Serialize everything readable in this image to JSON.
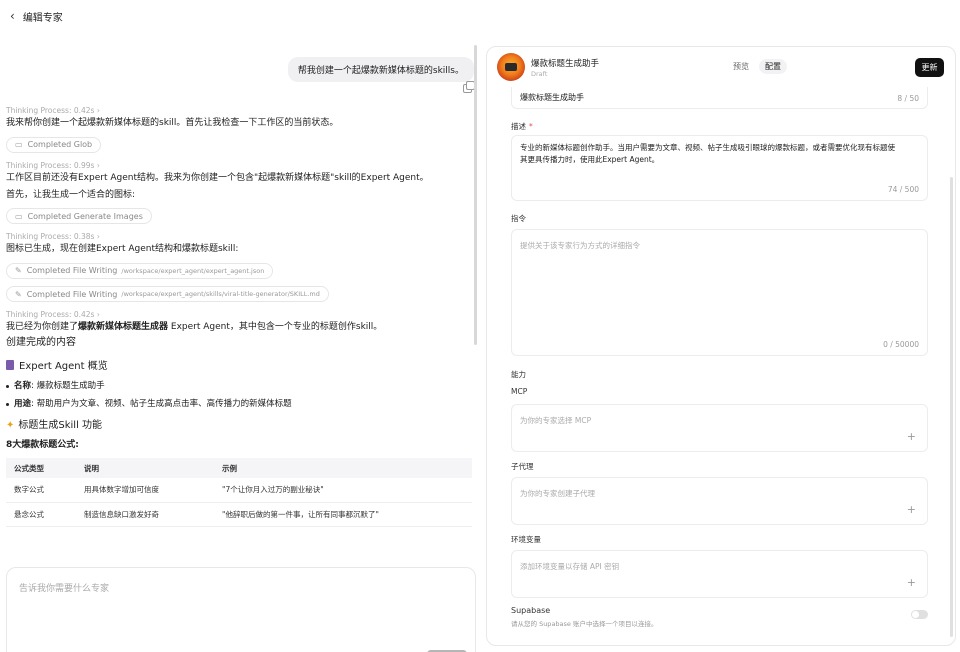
{
  "header": {
    "title": "编辑专家"
  },
  "chat": {
    "user_message": "帮我创建一个起爆款新媒体标题的skills。",
    "t1": "Thinking Process: 0.42s",
    "m1": "我来帮你创建一个起爆款新媒体标题的skill。首先让我检查一下工作区的当前状态。",
    "p1": "Completed Glob",
    "t2": "Thinking Process: 0.99s",
    "m2": "工作区目前还没有Expert Agent结构。我来为你创建一个包含\"起爆款新媒体标题\"skill的Expert Agent。",
    "m2b": "首先，让我生成一个适合的图标:",
    "p2": "Completed Generate Images",
    "t3": "Thinking Process: 0.38s",
    "m3": "图标已生成，现在创建Expert Agent结构和爆款标题skill:",
    "p3": "Completed File Writing",
    "p3path": "/workspace/expert_agent/expert_agent.json",
    "p4": "Completed File Writing",
    "p4path": "/workspace/expert_agent/skills/viral-title-generator/SKILL.md",
    "t4": "Thinking Process: 0.42s",
    "m4a": "我已经为你创建了",
    "m4b": "爆款新媒体标题生成器",
    "m4c": " Expert Agent，其中包含一个专业的标题创作skill。",
    "m5": "创建完成的内容",
    "h_overview": "Expert Agent 概览",
    "b1_key": "名称",
    "b1_val": ": 爆款标题生成助手",
    "b2_key": "用途",
    "b2_val": ": 帮助用户为文章、视频、帖子生成高点击率、高传播力的新媒体标题",
    "h_skill": "标题生成Skill 功能",
    "formula_title": "8大爆款标题公式:",
    "table": {
      "headers": [
        "公式类型",
        "说明",
        "示例"
      ],
      "rows": [
        [
          "数字公式",
          "用具体数字增加可信度",
          "\"7个让你月入过万的副业秘诀\""
        ],
        [
          "悬念公式",
          "制造信息缺口激发好奇",
          "\"他辞职后做的第一件事，让所有同事都沉默了\""
        ]
      ]
    }
  },
  "composer": {
    "placeholder": "告诉我你需要什么专家",
    "run_label": "run"
  },
  "panel": {
    "name": "爆款标题生成助手",
    "status": "Draft",
    "tab_preview": "预览",
    "tab_config": "配置",
    "update_label": "更新",
    "name_value": "爆款标题生成助手",
    "name_count": "8 / 50",
    "desc_label": "描述",
    "desc_required": "*",
    "desc_line1": "专业的新媒体标题创作助手。当用户需要为文章、视频、帖子生成吸引眼球的爆款标题，或者需要优化现有标题使",
    "desc_line2": "其更具传播力时，使用此Expert Agent。",
    "desc_count": "74 / 500",
    "instr_label": "指令",
    "instr_placeholder": "提供关于该专家行为方式的详细指令",
    "instr_count": "0 / 50000",
    "abilities_label": "能力",
    "mcp_label": "MCP",
    "mcp_placeholder": "为你的专家选择 MCP",
    "sub_label": "子代理",
    "sub_placeholder": "为你的专家创建子代理",
    "env_label": "环境变量",
    "env_placeholder": "添加环境变量以存储 API 密钥",
    "supa_label": "Supabase",
    "supa_desc": "请从您的 Supabase 账户中选择一个项目以连接。"
  }
}
